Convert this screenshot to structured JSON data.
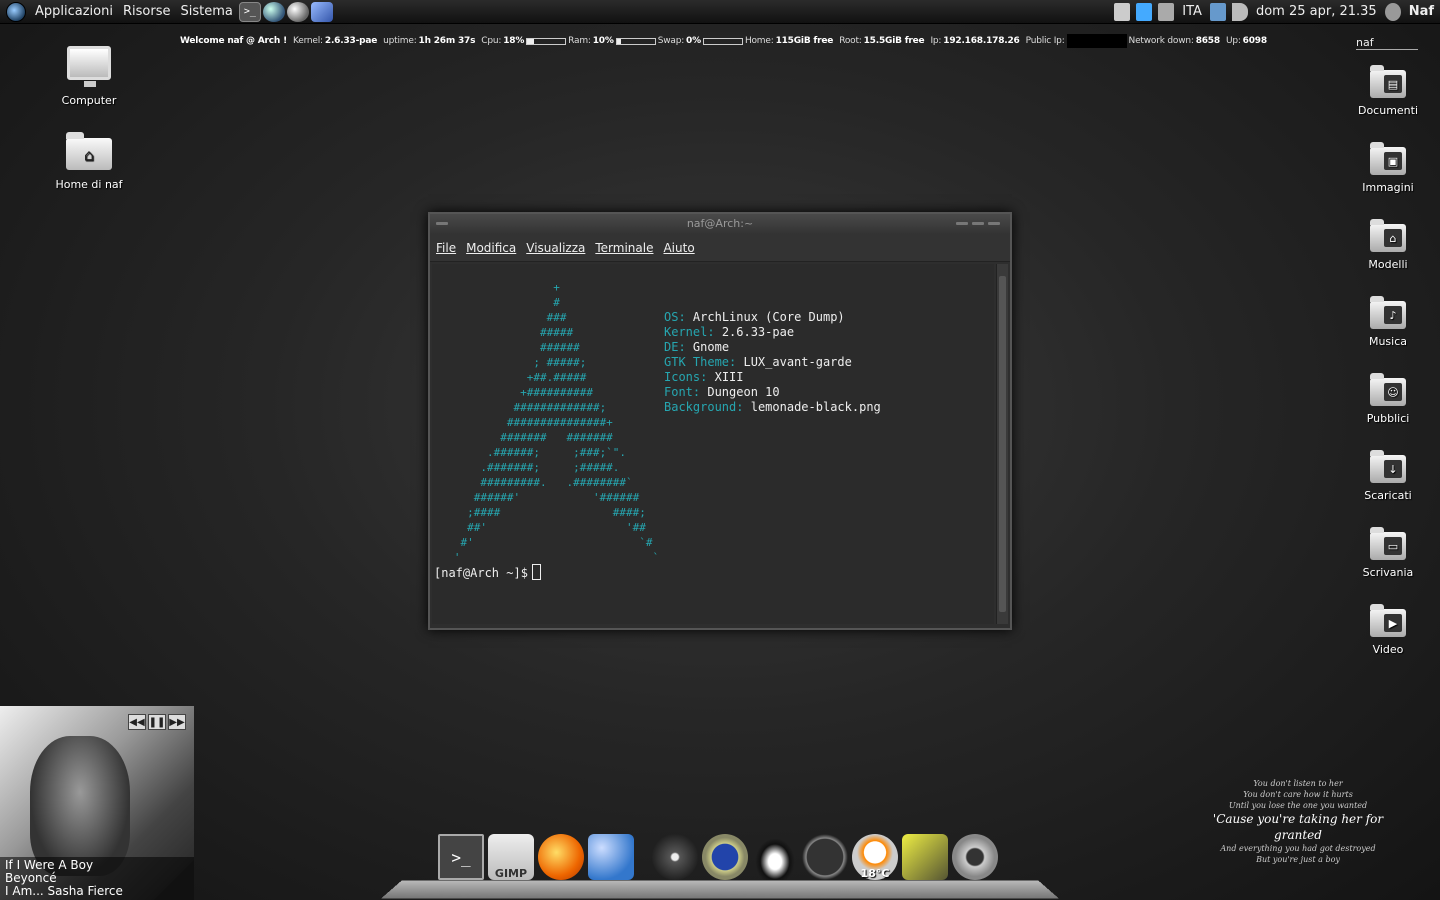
{
  "panel": {
    "menus": [
      "Applicazioni",
      "Risorse",
      "Sistema"
    ],
    "keyboard": "ITA",
    "clock": "dom 25 apr, 21.35",
    "user": "Naf"
  },
  "conky": {
    "welcome": "Welcome naf @ Arch !",
    "kernel_label": "Kernel:",
    "kernel": "2.6.33-pae",
    "uptime_label": "uptime:",
    "uptime": "1h 26m 37s",
    "cpu_label": "Cpu:",
    "cpu": "18%",
    "cpu_fill": 0.18,
    "ram_label": "Ram:",
    "ram": "10%",
    "ram_fill": 0.1,
    "swap_label": "Swap:",
    "swap": "0%",
    "swap_fill": 0.0,
    "home_label": "Home:",
    "home": "115GiB free",
    "root_label": "Root:",
    "root": "15.5GiB free",
    "ip_label": "Ip:",
    "ip": "192.168.178.26",
    "public_ip_label": "Public Ip:",
    "down_label": "Network down:",
    "down": "8658",
    "up_label": "Up:",
    "up": "6098"
  },
  "user_label": "naf",
  "desktop_left": [
    {
      "label": "Computer",
      "icon": "computer-icon"
    },
    {
      "label": "Home di naf",
      "icon": "home-folder-icon"
    }
  ],
  "desktop_right": [
    {
      "label": "Documenti",
      "glyph": "▤"
    },
    {
      "label": "Immagini",
      "glyph": "▣"
    },
    {
      "label": "Modelli",
      "glyph": "⌂"
    },
    {
      "label": "Musica",
      "glyph": "♪"
    },
    {
      "label": "Pubblici",
      "glyph": "☺"
    },
    {
      "label": "Scaricati",
      "glyph": "↓"
    },
    {
      "label": "Scrivania",
      "glyph": "▭"
    },
    {
      "label": "Video",
      "glyph": "▶"
    }
  ],
  "terminal": {
    "title": "naf@Arch:~",
    "menu": [
      "File",
      "Modifica",
      "Visualizza",
      "Terminale",
      "Aiuto"
    ],
    "ascii_art": "                  +\n                  #\n                 ###\n                #####\n                ######\n               ; #####;\n              +##.#####\n             +##########\n            #############;\n           ###############+\n          #######   #######\n        .######;     ;###;`\".\n       .#######;     ;#####.\n       #########.   .########`\n      ######'           '######\n     ;####                 ####;\n     ##'                     '##\n    #'                         `#\n   '                             `",
    "info": [
      {
        "key": "OS:",
        "value": "ArchLinux (Core Dump)"
      },
      {
        "key": "Kernel:",
        "value": "2.6.33-pae"
      },
      {
        "key": "DE:",
        "value": "Gnome"
      },
      {
        "key": "GTK Theme:",
        "value": "LUX_avant-garde"
      },
      {
        "key": "Icons:",
        "value": "XIII"
      },
      {
        "key": "Font:",
        "value": "Dungeon 10"
      },
      {
        "key": "Background:",
        "value": "lemonade-black.png"
      }
    ],
    "prompt": "[naf@Arch ~]$"
  },
  "music": {
    "title": "If I Were A Boy",
    "artist": "Beyoncé",
    "album": "I Am... Sasha Fierce",
    "controls": [
      "◀◀",
      "❚❚",
      "▶▶"
    ]
  },
  "lyrics": [
    {
      "text": "You don't listen to her",
      "big": false
    },
    {
      "text": "You don't care how it hurts",
      "big": false
    },
    {
      "text": "Until you lose the one you wanted",
      "big": false
    },
    {
      "text": "'Cause you're taking her for granted",
      "big": true
    },
    {
      "text": "And everything you had got destroyed",
      "big": false
    },
    {
      "text": "But you're just a boy",
      "big": false
    }
  ],
  "dock": {
    "terminal_glyph": ">_",
    "gimp_label": "GIMP",
    "weather_temp": "18°C"
  }
}
